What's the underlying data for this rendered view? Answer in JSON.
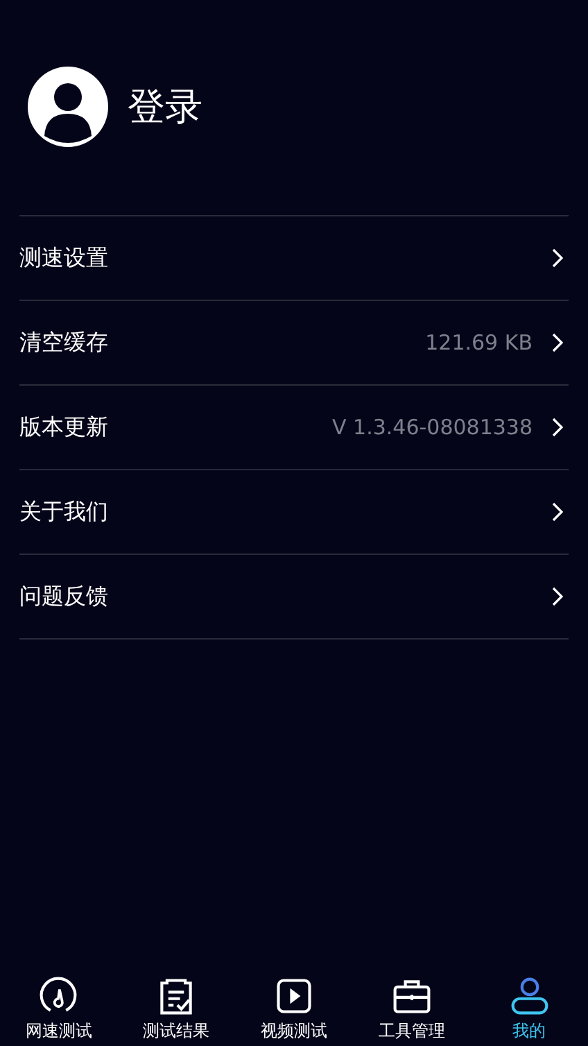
{
  "profile": {
    "login_label": "登录"
  },
  "settings": [
    {
      "label": "测速设置"
    },
    {
      "label": "清空缓存",
      "value": "121.69 KB"
    },
    {
      "label": "版本更新",
      "value": "V 1.3.46-08081338"
    },
    {
      "label": "关于我们"
    },
    {
      "label": "问题反馈"
    }
  ],
  "tabs": [
    {
      "label": "网速测试",
      "kind": "speed",
      "selected": false
    },
    {
      "label": "测试结果",
      "kind": "results",
      "selected": false
    },
    {
      "label": "视频测试",
      "kind": "video",
      "selected": false
    },
    {
      "label": "工具管理",
      "kind": "tools",
      "selected": false
    },
    {
      "label": "我的",
      "kind": "profile",
      "selected": true
    }
  ]
}
